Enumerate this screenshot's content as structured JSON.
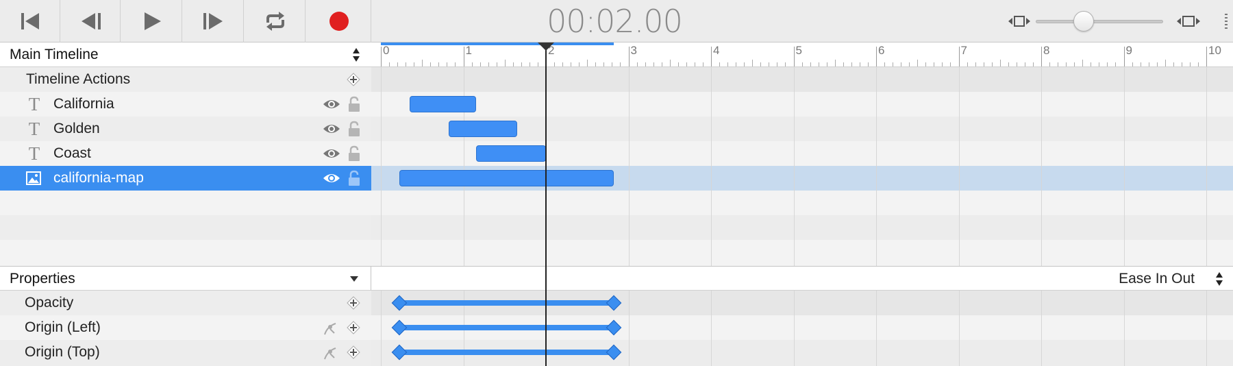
{
  "toolbar": {
    "buttons": [
      "skip-to-start",
      "step-back",
      "play",
      "step-forward",
      "loop",
      "record"
    ],
    "timecode": "00:02.00",
    "zoom_level": 0.35
  },
  "timeline": {
    "title": "Main Timeline",
    "ruler_labels": [
      "0",
      "1",
      "2",
      "3",
      "4",
      "5",
      "6",
      "7",
      "8",
      "9",
      "10"
    ],
    "actions_label": "Timeline Actions",
    "elements": [
      {
        "label": "California",
        "type": "text",
        "start": 0.35,
        "end": 1.15
      },
      {
        "label": "Golden",
        "type": "text",
        "start": 0.82,
        "end": 1.65
      },
      {
        "label": "Coast",
        "type": "text",
        "start": 1.15,
        "end": 2.0
      },
      {
        "label": "california-map",
        "type": "image",
        "start": 0.22,
        "end": 2.82,
        "selected": true
      }
    ],
    "playhead_time": 2.0,
    "range_end": 2.82
  },
  "properties": {
    "title": "Properties",
    "easing": "Ease In Out",
    "items": [
      {
        "label": "Opacity",
        "kf_start": 0.22,
        "kf_end": 2.82
      },
      {
        "label": "Origin (Left)",
        "kf_start": 0.22,
        "kf_end": 2.82
      },
      {
        "label": "Origin (Top)",
        "kf_start": 0.22,
        "kf_end": 2.82
      }
    ]
  },
  "colors": {
    "accent": "#3a8ef0",
    "record": "#e02020"
  }
}
